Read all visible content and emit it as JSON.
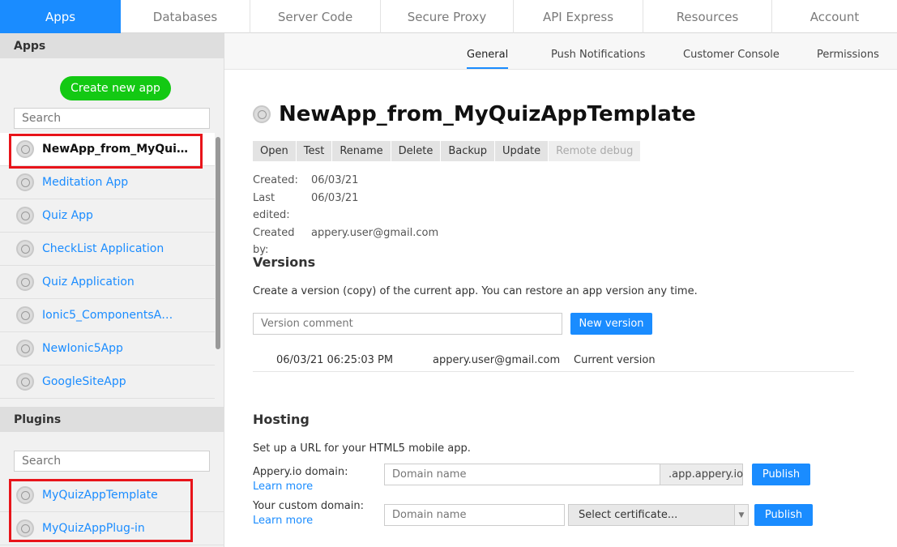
{
  "topnav": {
    "tabs": [
      {
        "label": "Apps",
        "active": true
      },
      {
        "label": "Databases"
      },
      {
        "label": "Server Code"
      },
      {
        "label": "Secure Proxy"
      },
      {
        "label": "API Express"
      },
      {
        "label": "Resources"
      },
      {
        "label": "Account"
      }
    ]
  },
  "sidebar": {
    "apps_heading": "Apps",
    "create_button": "Create new app",
    "search_placeholder": "Search",
    "apps": [
      {
        "label": "NewApp_from_MyQui…",
        "selected": true
      },
      {
        "label": "Meditation App"
      },
      {
        "label": "Quiz App"
      },
      {
        "label": "CheckList Application"
      },
      {
        "label": "Quiz Application"
      },
      {
        "label": "Ionic5_ComponentsA…"
      },
      {
        "label": "NewIonic5App"
      },
      {
        "label": "GoogleSiteApp"
      }
    ],
    "plugins_heading": "Plugins",
    "plugins_search_placeholder": "Search",
    "plugins": [
      {
        "label": "MyQuizAppTemplate"
      },
      {
        "label": "MyQuizAppPlug-in"
      }
    ]
  },
  "subtabs": {
    "general": "General",
    "push": "Push Notifications",
    "console": "Customer Console",
    "permissions": "Permissions"
  },
  "main": {
    "title": "NewApp_from_MyQuizAppTemplate",
    "actions": [
      "Open",
      "Test",
      "Rename",
      "Delete",
      "Backup",
      "Update",
      "Remote debug"
    ],
    "meta": {
      "created_label": "Created:",
      "created_value": "06/03/21",
      "edited_label": "Last edited:",
      "edited_value": "06/03/21",
      "by_label": "Created by:",
      "by_value": "appery.user@gmail.com"
    },
    "versions": {
      "heading": "Versions",
      "description": "Create a version (copy) of the current app. You can restore an app version any time.",
      "comment_placeholder": "Version comment",
      "new_button": "New version",
      "row": {
        "date": "06/03/21 06:25:03 PM",
        "user": "appery.user@gmail.com",
        "status": "Current version"
      }
    },
    "hosting": {
      "heading": "Hosting",
      "description": "Set up a URL for your HTML5 mobile app.",
      "appery_label": "Appery.io domain:",
      "learn_more": "Learn more",
      "domain_placeholder": "Domain name",
      "suffix": ".app.appery.io",
      "publish": "Publish",
      "custom_label": "Your custom domain:",
      "learn_more_2": "Learn more",
      "custom_placeholder": "Domain name",
      "certificate": "Select certificate...",
      "publish_2": "Publish"
    }
  }
}
